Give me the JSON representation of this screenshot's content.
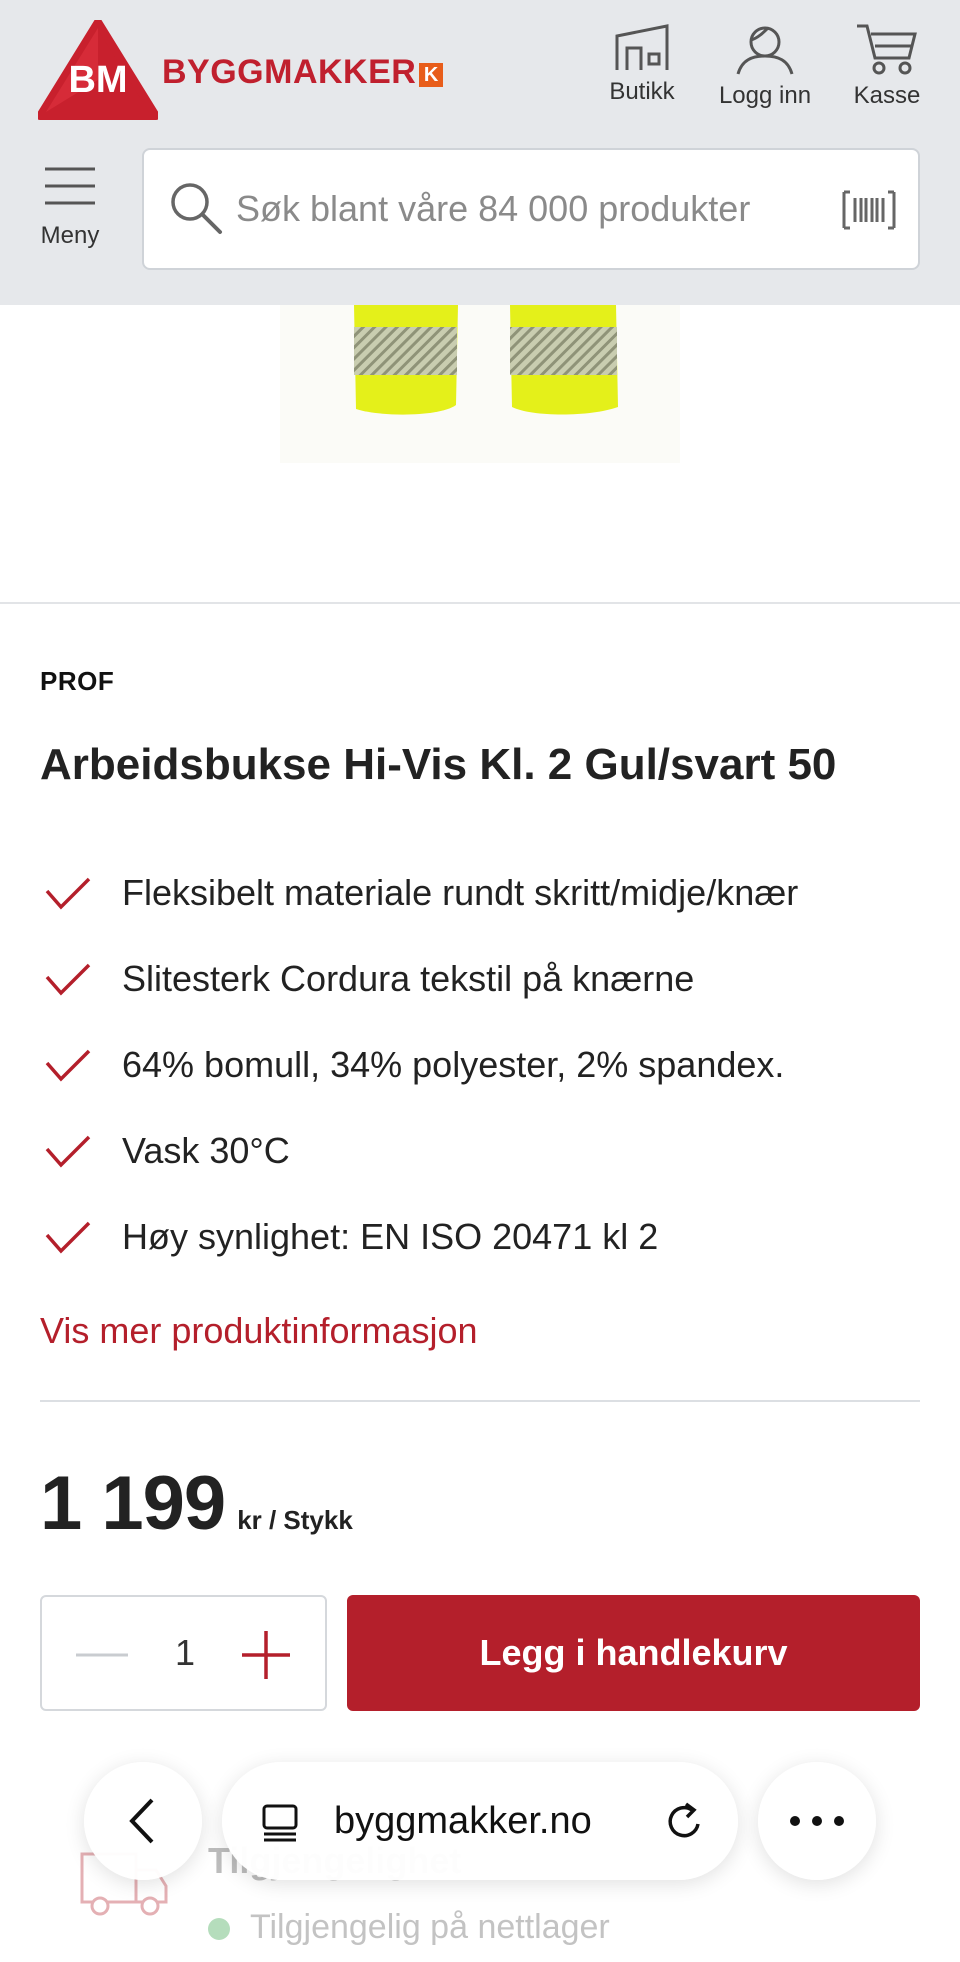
{
  "header": {
    "logo_badge": "BM",
    "logo_text": "BYGGMAKKER",
    "logo_k": "K",
    "store_label": "Butikk",
    "login_label": "Logg inn",
    "checkout_label": "Kasse",
    "menu_label": "Meny",
    "search_placeholder": "Søk blant våre 84 000 produkter"
  },
  "product": {
    "brand": "PROF",
    "title": "Arbeidsbukse Hi-Vis Kl. 2 Gul/svart 50",
    "features": [
      "Fleksibelt materiale rundt skritt/midje/knær",
      "Slitesterk Cordura tekstil på knærne",
      "64% bomull, 34% polyester, 2% spandex.",
      "Vask 30°C",
      "Høy synlighet: EN ISO 20471 kl 2"
    ],
    "more_info_link": "Vis mer produktinformasjon",
    "price": "1 199",
    "price_unit": "kr / Stykk",
    "quantity": "1",
    "add_to_cart": "Legg i handlekurv",
    "stock_title": "Tilgjengelighet",
    "stock_status": "Tilgjengelig på nettlager"
  },
  "browser": {
    "url": "byggmakker.no"
  },
  "colors": {
    "brand_red": "#b41f2b",
    "header_bg": "#e6e8eb",
    "hivis_yellow": "#e9f51c"
  }
}
